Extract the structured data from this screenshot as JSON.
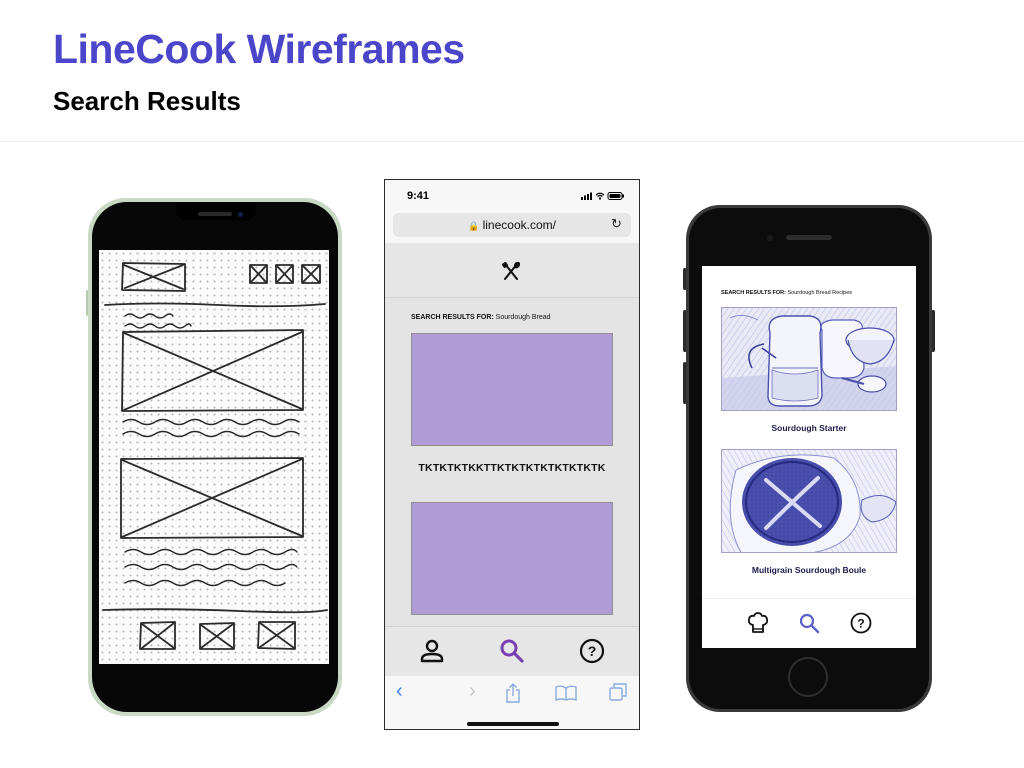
{
  "slide": {
    "title": "LineCook Wireframes",
    "subtitle": "Search Results"
  },
  "browser_mockup": {
    "status_time": "9:41",
    "url": "linecook.com/",
    "search_label": "SEARCH RESULTS FOR:",
    "search_query": "Sourdough Bread",
    "result_caption": "TKTKTKTKKTTKTKTKTKTKTKTKTK",
    "placeholder_color": "#b09cd6",
    "nav_accent_color": "#7a3fb0",
    "tab_icons": [
      "user-icon",
      "search-icon",
      "help-icon"
    ],
    "toolbar_icons": [
      "back-icon",
      "forward-icon",
      "share-icon",
      "bookmarks-icon",
      "tabs-icon"
    ]
  },
  "hifi_mockup": {
    "search_label": "SEARCH RESULTS FOR:",
    "search_query": "Sourdough Bread Recipes",
    "results": [
      {
        "title": "Sourdough Starter",
        "image": "jars-and-spoon-sketch"
      },
      {
        "title": "Multigrain Sourdough Boule",
        "image": "bread-loaf-sketch"
      }
    ],
    "accent_color": "#5b5fc7",
    "tab_icons": [
      "chef-hat-icon",
      "search-icon",
      "help-icon"
    ]
  }
}
